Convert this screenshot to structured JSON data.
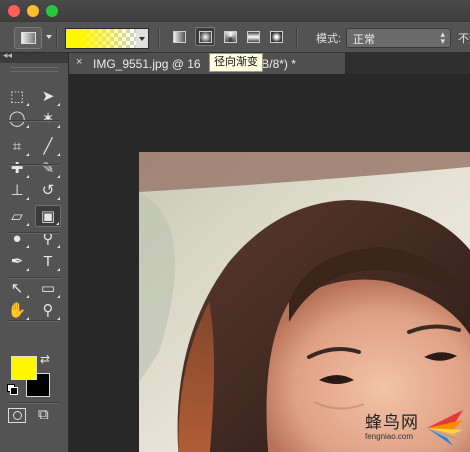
{
  "window": {
    "traffic_lights": {
      "close": "#ff5f57",
      "minimize": "#ffbd2e",
      "zoom": "#28c840"
    }
  },
  "options_bar": {
    "tool_preset_icon": "gradient-tool-icon",
    "gradient_colors": {
      "start": "#fff700",
      "end": "transparent"
    },
    "gradient_types": [
      {
        "name": "linear-gradient-icon",
        "selected": false
      },
      {
        "name": "radial-gradient-icon",
        "selected": true
      },
      {
        "name": "angle-gradient-icon",
        "selected": false
      },
      {
        "name": "reflected-gradient-icon",
        "selected": false
      },
      {
        "name": "diamond-gradient-icon",
        "selected": false
      }
    ],
    "mode_label": "模式:",
    "mode_value": "正常",
    "opacity_label": "不透"
  },
  "tooltip": {
    "text": "径向渐变"
  },
  "document_tab": {
    "close_glyph": "×",
    "title": "IMG_9551.jpg @ 16",
    "title_rest": ", RGB/8*) *"
  },
  "toolbox": {
    "collapse_glyph": "◂◂",
    "tools": [
      {
        "name": "marquee-tool-icon",
        "glyph": "⬚"
      },
      {
        "name": "move-tool-icon",
        "glyph": "➤"
      },
      {
        "name": "lasso-tool-icon",
        "glyph": "◯"
      },
      {
        "name": "magic-wand-tool-icon",
        "glyph": "✶"
      },
      {
        "name": "crop-tool-icon",
        "glyph": "⌗"
      },
      {
        "name": "eyedropper-tool-icon",
        "glyph": "╱"
      },
      {
        "name": "healing-brush-tool-icon",
        "glyph": "✚"
      },
      {
        "name": "brush-tool-icon",
        "glyph": "✎"
      },
      {
        "name": "clone-stamp-tool-icon",
        "glyph": "⊥"
      },
      {
        "name": "history-brush-tool-icon",
        "glyph": "↺"
      },
      {
        "name": "eraser-tool-icon",
        "glyph": "▱"
      },
      {
        "name": "gradient-tool-icon",
        "glyph": "▣"
      },
      {
        "name": "blur-tool-icon",
        "glyph": "●"
      },
      {
        "name": "dodge-tool-icon",
        "glyph": "⚲"
      },
      {
        "name": "pen-tool-icon",
        "glyph": "✒"
      },
      {
        "name": "type-tool-icon",
        "glyph": "T"
      },
      {
        "name": "path-selection-tool-icon",
        "glyph": "↖"
      },
      {
        "name": "rectangle-tool-icon",
        "glyph": "▭"
      },
      {
        "name": "hand-tool-icon",
        "glyph": "✋"
      },
      {
        "name": "zoom-tool-icon",
        "glyph": "⚲"
      }
    ],
    "foreground_color": "#fff700",
    "background_color": "#000000",
    "swap_glyph": "⇄",
    "quick_mask_glyph": "◙",
    "screen_mode_glyph": "⧉"
  },
  "watermark": {
    "text": "蜂鸟网",
    "url": "fengniao.com"
  }
}
